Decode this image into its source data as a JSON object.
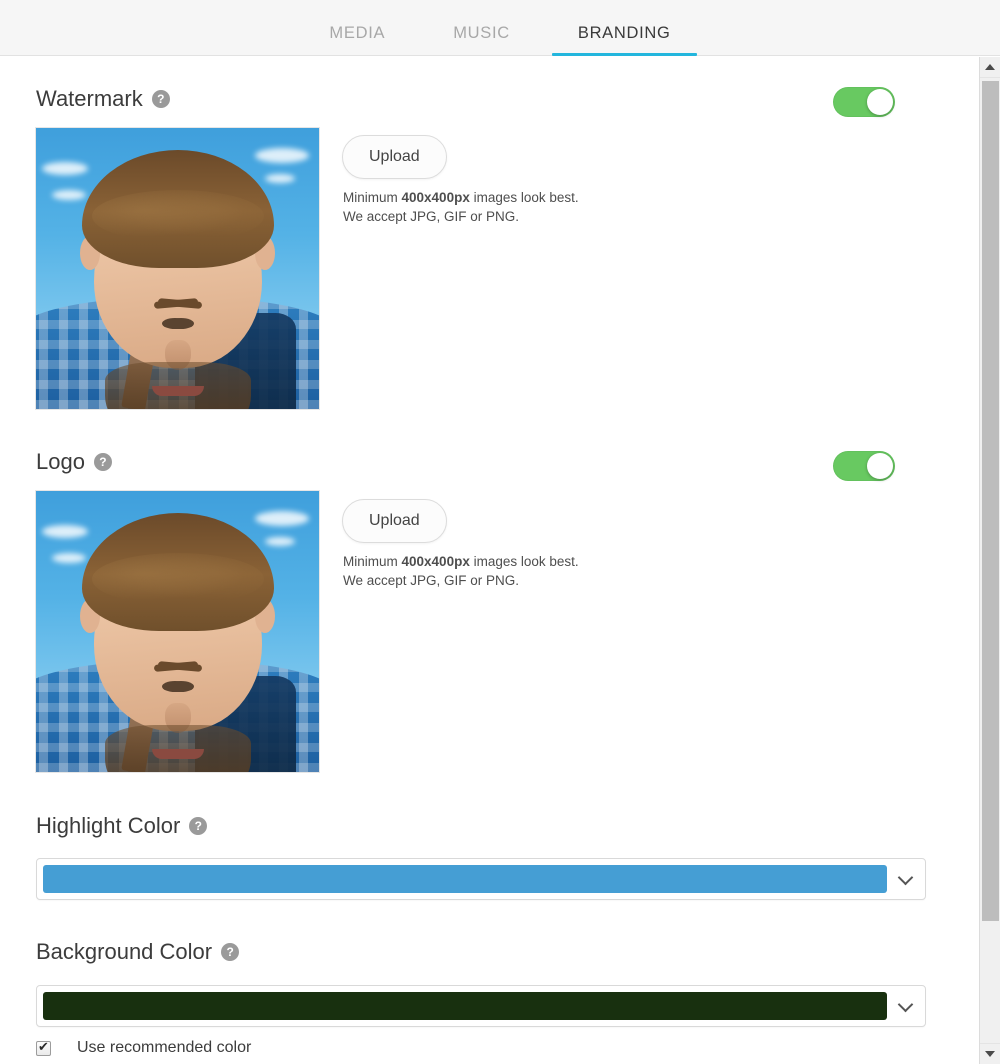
{
  "tabs": [
    {
      "label": "MEDIA",
      "active": false
    },
    {
      "label": "MUSIC",
      "active": false
    },
    {
      "label": "BRANDING",
      "active": true
    }
  ],
  "theme": {
    "accent": "#23b6dd",
    "toggle_on": "#68c961",
    "header_bg": "#f6f6f6",
    "text": "#3c3c3c"
  },
  "sections": {
    "watermark": {
      "title": "Watermark",
      "help": "?",
      "toggle_state": "on",
      "upload_label": "Upload",
      "note_line1_prefix": "Minimum ",
      "note_line1_bold": "400x400px",
      "note_line1_suffix": " images look best.",
      "note_line2": "We accept JPG, GIF or PNG.",
      "image_alt": "portrait-photo"
    },
    "logo": {
      "title": "Logo",
      "help": "?",
      "toggle_state": "on",
      "upload_label": "Upload",
      "note_line1_prefix": "Minimum ",
      "note_line1_bold": "400x400px",
      "note_line1_suffix": " images look best.",
      "note_line2": "We accept JPG, GIF or PNG.",
      "image_alt": "portrait-photo"
    },
    "highlight_color": {
      "title": "Highlight Color",
      "help": "?",
      "value": "#459ed4"
    },
    "background_color": {
      "title": "Background Color",
      "help": "?",
      "value": "#18300f",
      "checkbox_label": "Use recommended color",
      "checkbox_checked": true
    }
  },
  "scrollbar": {
    "up_arrow": "▲",
    "down_arrow": "▼"
  }
}
